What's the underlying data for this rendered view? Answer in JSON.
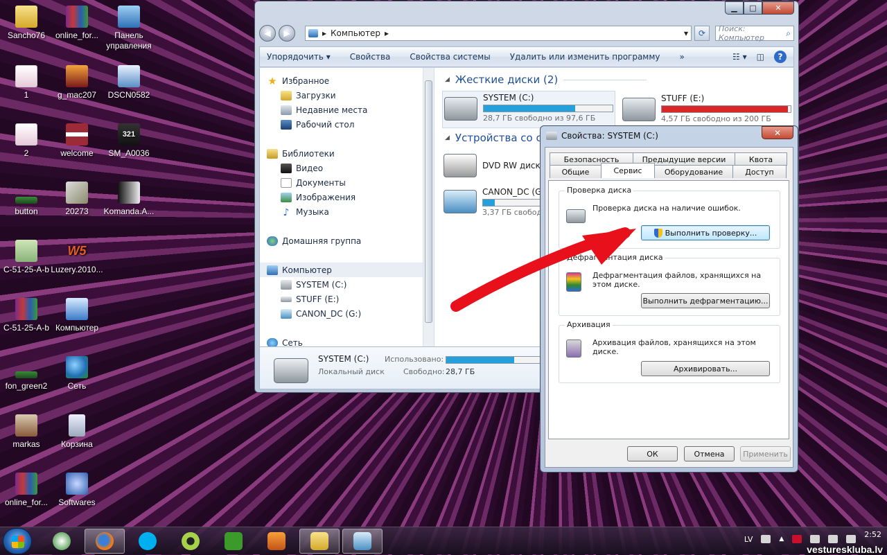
{
  "desktop": {
    "icons": [
      {
        "label": "Sancho76"
      },
      {
        "label": "online_for..."
      },
      {
        "label": "Панель управления"
      },
      {
        "label": "1"
      },
      {
        "label": "g_mac207"
      },
      {
        "label": "DSCN0582"
      },
      {
        "label": "2"
      },
      {
        "label": "welcome"
      },
      {
        "label": "SM_A0036"
      },
      {
        "label": "button"
      },
      {
        "label": "20273"
      },
      {
        "label": "Komanda.A..."
      },
      {
        "label": "C-51-25-A-b"
      },
      {
        "label": "Luzery.2010..."
      },
      {
        "label": "C-51-25-A-b"
      },
      {
        "label": "Компьютер"
      },
      {
        "label": "fon_green2"
      },
      {
        "label": "Сеть"
      },
      {
        "label": "markas"
      },
      {
        "label": "Корзина"
      },
      {
        "label": "online_for..."
      },
      {
        "label": "Softwares"
      }
    ],
    "icon_321_text": "321",
    "icon_luz_text": "W5"
  },
  "explorer": {
    "window_buttons": {
      "minimize": "▁",
      "maximize": "□",
      "close": "✕"
    },
    "nav": {
      "back": "◀",
      "forward": "▶"
    },
    "address": {
      "path": "Компьютер",
      "sep": "▸",
      "dropdown": "▾",
      "refresh": "⟳"
    },
    "search": {
      "placeholder": "Поиск: Компьютер",
      "icon": "⌕"
    },
    "toolbar": {
      "organize": "Упорядочить ▾",
      "properties": "Свойства",
      "system_properties": "Свойства системы",
      "uninstall": "Удалить или изменить программу",
      "more": "»",
      "view": "☷ ▾",
      "preview": "◫",
      "help": "?"
    },
    "navpane": {
      "favorites": "Избранное",
      "downloads": "Загрузки",
      "recent": "Недавние места",
      "desktop": "Рабочий стол",
      "libraries": "Библиотеки",
      "video": "Видео",
      "documents": "Документы",
      "images": "Изображения",
      "music": "Музыка",
      "homegroup": "Домашняя группа",
      "computer": "Компьютер",
      "system_c": "SYSTEM (C:)",
      "stuff_e": "STUFF (E:)",
      "canon_g": "CANON_DC (G:)",
      "network": "Сеть"
    },
    "groups": {
      "hard_disks": "Жесткие диски (2)",
      "removable": "Устройства со съе"
    },
    "drives": {
      "system": {
        "name": "SYSTEM (C:)",
        "free": "28,7 ГБ свободно из 97,6 ГБ",
        "used_fraction": 0.71,
        "color": "#26a0da"
      },
      "stuff": {
        "name": "STUFF (E:)",
        "free": "4,57 ГБ свободно из 200 ГБ",
        "used_fraction": 0.98,
        "color": "#da2626"
      },
      "dvd": {
        "name": "DVD RW диско"
      },
      "canon": {
        "name": "CANON_DC (G",
        "free": "3,37 ГБ свобод",
        "used_fraction": 0.2,
        "color": "#26a0da"
      }
    },
    "details": {
      "name": "SYSTEM (C:)",
      "type": "Локальный диск",
      "used_label": "Использовано:",
      "free_label": "Свободно:",
      "free_value": "28,7 ГБ",
      "used_fraction": 0.71
    }
  },
  "dialog": {
    "title": "Свойства: SYSTEM (C:)",
    "close": "✕",
    "tabs_top": [
      "Безопасность",
      "Предыдущие версии",
      "Квота"
    ],
    "tabs_bottom": [
      "Общие",
      "Сервис",
      "Оборудование",
      "Доступ"
    ],
    "active_tab": "Сервис",
    "check": {
      "title": "Проверка диска",
      "text": "Проверка диска на наличие ошибок.",
      "button": "Выполнить проверку..."
    },
    "defrag": {
      "title": "Дефрагментация диска",
      "text": "Дефрагментация файлов, хранящихся на этом диске.",
      "button": "Выполнить дефрагментацию..."
    },
    "backup": {
      "title": "Архивация",
      "text": "Архивация файлов, хранящихся на этом диске.",
      "button": "Архивировать..."
    },
    "ok": "ОК",
    "cancel": "Отмена",
    "apply": "Применить"
  },
  "taskbar": {
    "language": "LV",
    "time": "2:52"
  },
  "watermark": "vestureskluba.lv"
}
